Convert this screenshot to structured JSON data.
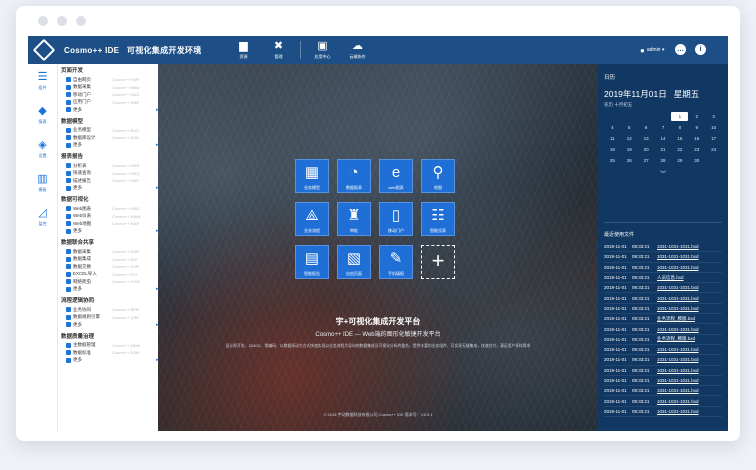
{
  "app": {
    "title": "Cosmo++ IDE",
    "subtitle": "可视化集成开发环境",
    "user": "admin"
  },
  "nav": [
    {
      "icon": "folder-icon",
      "glyph": "▆",
      "label": "资源"
    },
    {
      "icon": "tools-icon",
      "glyph": "✖",
      "label": "管理"
    },
    {
      "icon": "briefcase-icon",
      "glyph": "▣",
      "label": "应用中心"
    },
    {
      "icon": "cloud-upload-icon",
      "glyph": "☁",
      "label": "云端协作"
    }
  ],
  "rail": [
    {
      "icon": "list-icon",
      "glyph": "☰",
      "label": "组件"
    },
    {
      "icon": "cube-icon",
      "glyph": "◆",
      "label": "报表"
    },
    {
      "icon": "layers-icon",
      "glyph": "◈",
      "label": "设置"
    },
    {
      "icon": "columns-icon",
      "glyph": "▥",
      "label": "模板"
    },
    {
      "icon": "chart-icon",
      "glyph": "◿",
      "label": "监控"
    }
  ],
  "groups": [
    {
      "title": "页面开发",
      "items": [
        {
          "label": "自由网页",
          "sub": "Cosmo++ FWP"
        },
        {
          "label": "数据采集",
          "sub": "Cosmo++ MAN"
        },
        {
          "label": "移动门户",
          "sub": "Cosmo++ MAD"
        },
        {
          "label": "应用门户",
          "sub": "Cosmo++ WAP"
        },
        {
          "label": "更多",
          "sub": ""
        }
      ]
    },
    {
      "title": "数据模型",
      "items": [
        {
          "label": "业务模型",
          "sub": "Cosmo++ BUG"
        },
        {
          "label": "数据库设计",
          "sub": "Cosmo++ DDD"
        },
        {
          "label": "更多",
          "sub": ""
        }
      ]
    },
    {
      "title": "报表报告",
      "items": [
        {
          "label": "分析表",
          "sub": "Cosmo++ MAR"
        },
        {
          "label": "快速查询",
          "sub": "Cosmo++ MXQ"
        },
        {
          "label": "描述报告",
          "sub": "Cosmo++ MAP"
        },
        {
          "label": "更多",
          "sub": ""
        }
      ]
    },
    {
      "title": "数据可视化",
      "items": [
        {
          "label": "Web图表",
          "sub": "Cosmo++ MWC"
        },
        {
          "label": "Web仪表",
          "sub": "Cosmo++ MWM"
        },
        {
          "label": "Web地图",
          "sub": "Cosmo++ MAP"
        },
        {
          "label": "更多",
          "sub": ""
        }
      ]
    },
    {
      "title": "数据联合共享",
      "items": [
        {
          "label": "数据采集",
          "sub": "Cosmo++ DAR"
        },
        {
          "label": "数据集成",
          "sub": "Cosmo++ DIP"
        },
        {
          "label": "数据交换",
          "sub": "Cosmo++ DXR"
        },
        {
          "label": "EXCEL导入",
          "sub": "Cosmo++ EXI"
        },
        {
          "label": "网络爬虫",
          "sub": "Cosmo++ CWS"
        },
        {
          "label": "更多",
          "sub": ""
        }
      ]
    },
    {
      "title": "流程逻辑协同",
      "items": [
        {
          "label": "业务协同",
          "sub": "Cosmo++ BPM"
        },
        {
          "label": "数据规则引擎",
          "sub": "Cosmo++ QSE"
        },
        {
          "label": "更多",
          "sub": ""
        }
      ]
    },
    {
      "title": "数据质量治理",
      "items": [
        {
          "label": "主数据管理",
          "sub": "Cosmo++ MDM"
        },
        {
          "label": "数据标准",
          "sub": "Cosmo++ DSM"
        },
        {
          "label": "更多",
          "sub": ""
        }
      ]
    }
  ],
  "tiles": [
    {
      "icon": "grid-icon",
      "glyph": "▦",
      "label": "业务模型"
    },
    {
      "icon": "pie-chart-icon",
      "glyph": "◔",
      "label": "数据报表"
    },
    {
      "icon": "browser-e-icon",
      "glyph": "e",
      "label": "web图表"
    },
    {
      "icon": "map-pin-icon",
      "glyph": "⚲",
      "label": "地图"
    },
    {
      "icon": "share-icon",
      "glyph": "⟁",
      "label": "业务流程"
    },
    {
      "icon": "stamp-icon",
      "glyph": "♜",
      "label": "审批"
    },
    {
      "icon": "mobile-icon",
      "glyph": "▯",
      "label": "移动门户"
    },
    {
      "icon": "list-doc-icon",
      "glyph": "☷",
      "label": "智能设表"
    },
    {
      "icon": "note-icon",
      "glyph": "▤",
      "label": "智能报告"
    },
    {
      "icon": "template-icon",
      "glyph": "▧",
      "label": "自由页面"
    },
    {
      "icon": "edit-doc-icon",
      "glyph": "✎",
      "label": "手机填报"
    },
    {
      "icon": "plus-icon",
      "glyph": "+",
      "label": ""
    }
  ],
  "desktop": {
    "title": "宇+可视化集成开发平台",
    "subtitle": "Cosmo++ IDE — Web端的图形化敏捷开发平台",
    "description": "设计即开发，以MDD、零编码、以数据驱动为方式快速实现以业务流程为导向的数据集成及可视化分析的整合，提供丰富的业务组件，可实现无缝集成，快速交付，满足用户多样需求",
    "copyright": "© 2018 宇动数据科技有限公司 Cosmo++ IDE 版本号：V5.0.1"
  },
  "calendar": {
    "header": "日历",
    "date": "2019年11月01日",
    "weekday": "星期五",
    "lunar": "农历 十月初五",
    "days": [
      "",
      "",
      "",
      "",
      "1",
      "2",
      "3",
      "4",
      "5",
      "6",
      "7",
      "8",
      "9",
      "10",
      "11",
      "12",
      "13",
      "14",
      "15",
      "16",
      "17",
      "18",
      "19",
      "20",
      "21",
      "22",
      "23",
      "24",
      "25",
      "26",
      "27",
      "28",
      "29",
      "30",
      ""
    ],
    "today": "1",
    "more": "︾"
  },
  "recent": {
    "title": "最近使用文件",
    "files": [
      {
        "date": "2019-11-01",
        "time": "09:33:21",
        "name": "1031-1031-1031.bxd"
      },
      {
        "date": "2019-11-01",
        "time": "09:33:21",
        "name": "1031-1031-1031.bxd"
      },
      {
        "date": "2019-11-01",
        "time": "09:33:21",
        "name": "1031-1031-1031.bxd"
      },
      {
        "date": "2019-11-01",
        "time": "09:33:21",
        "name": "人员信息.bxd"
      },
      {
        "date": "2019-11-01",
        "time": "09:33:21",
        "name": "1031-1031-1031.bxd"
      },
      {
        "date": "2019-11-01",
        "time": "09:33:21",
        "name": "1031-1031-1031.bxd"
      },
      {
        "date": "2019-11-01",
        "time": "09:33:21",
        "name": "1031-1031-1031.bxd"
      },
      {
        "date": "2019-11-01",
        "time": "09:33:21",
        "name": "业务流程_模版.bxd"
      },
      {
        "date": "2019-11-01",
        "time": "09:33:21",
        "name": "1031-1031-1031.bxd"
      },
      {
        "date": "2019-11-01",
        "time": "09:33:21",
        "name": "业务流程_模版.bxd"
      },
      {
        "date": "2019-11-01",
        "time": "09:33:21",
        "name": "1031-1031-1031.bxd"
      },
      {
        "date": "2019-11-01",
        "time": "09:33:21",
        "name": "1031-1031-1031.bxd"
      },
      {
        "date": "2019-11-01",
        "time": "09:33:21",
        "name": "1031-1031-1031.bxd"
      },
      {
        "date": "2019-11-01",
        "time": "09:33:21",
        "name": "1031-1031-1031.bxd"
      },
      {
        "date": "2019-11-01",
        "time": "09:33:21",
        "name": "1031-1031-1031.bxd"
      },
      {
        "date": "2019-11-01",
        "time": "09:33:21",
        "name": "1031-1031-1031.bxd"
      },
      {
        "date": "2019-11-01",
        "time": "09:33:21",
        "name": "1031-1031-1031.bxd"
      }
    ]
  }
}
